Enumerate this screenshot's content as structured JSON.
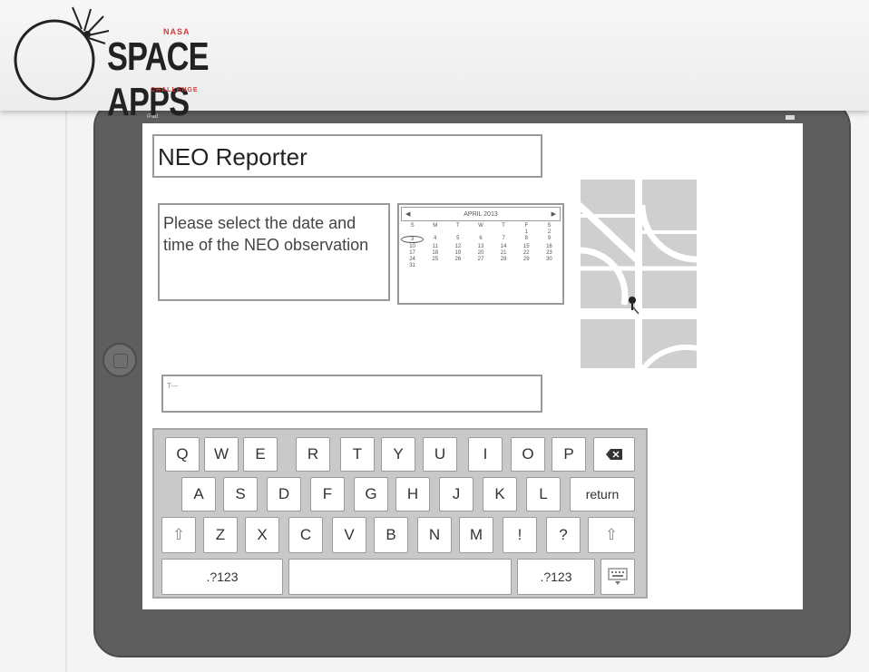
{
  "logo": {
    "top_small": "NASA",
    "main": "SPACE APPS",
    "bottom_small": "CHALLENGE"
  },
  "status_bar": {
    "device": "iPad"
  },
  "app": {
    "title": "NEO Reporter",
    "prompt": "Please select the date and time of the NEO observation",
    "input_placeholder": "T---"
  },
  "calendar": {
    "month_label": "APRIL 2013",
    "weekdays": [
      "S",
      "M",
      "T",
      "W",
      "T",
      "F",
      "S"
    ],
    "days": [
      "",
      "",
      "",
      "",
      "",
      "1",
      "2",
      "3",
      "4",
      "5",
      "6",
      "7",
      "8",
      "9",
      "10",
      "11",
      "12",
      "13",
      "14",
      "15",
      "16",
      "17",
      "18",
      "19",
      "20",
      "21",
      "22",
      "23",
      "24",
      "25",
      "26",
      "27",
      "28",
      "29",
      "30",
      "31"
    ],
    "selected_day": "3"
  },
  "keyboard": {
    "row1": [
      "Q",
      "W",
      "E",
      "R",
      "T",
      "Y",
      "U",
      "I",
      "O",
      "P"
    ],
    "row2": [
      "A",
      "S",
      "D",
      "F",
      "G",
      "H",
      "J",
      "K",
      "L"
    ],
    "return_label": "return",
    "row3": [
      "Z",
      "X",
      "C",
      "V",
      "B",
      "N",
      "M",
      "!",
      "?"
    ],
    "numbers_label": ".?123"
  },
  "icons": {
    "shift": "shift-arrow-icon",
    "delete": "backspace-icon",
    "hide_keyboard": "keyboard-hide-icon",
    "map_pin": "map-pin-icon"
  }
}
